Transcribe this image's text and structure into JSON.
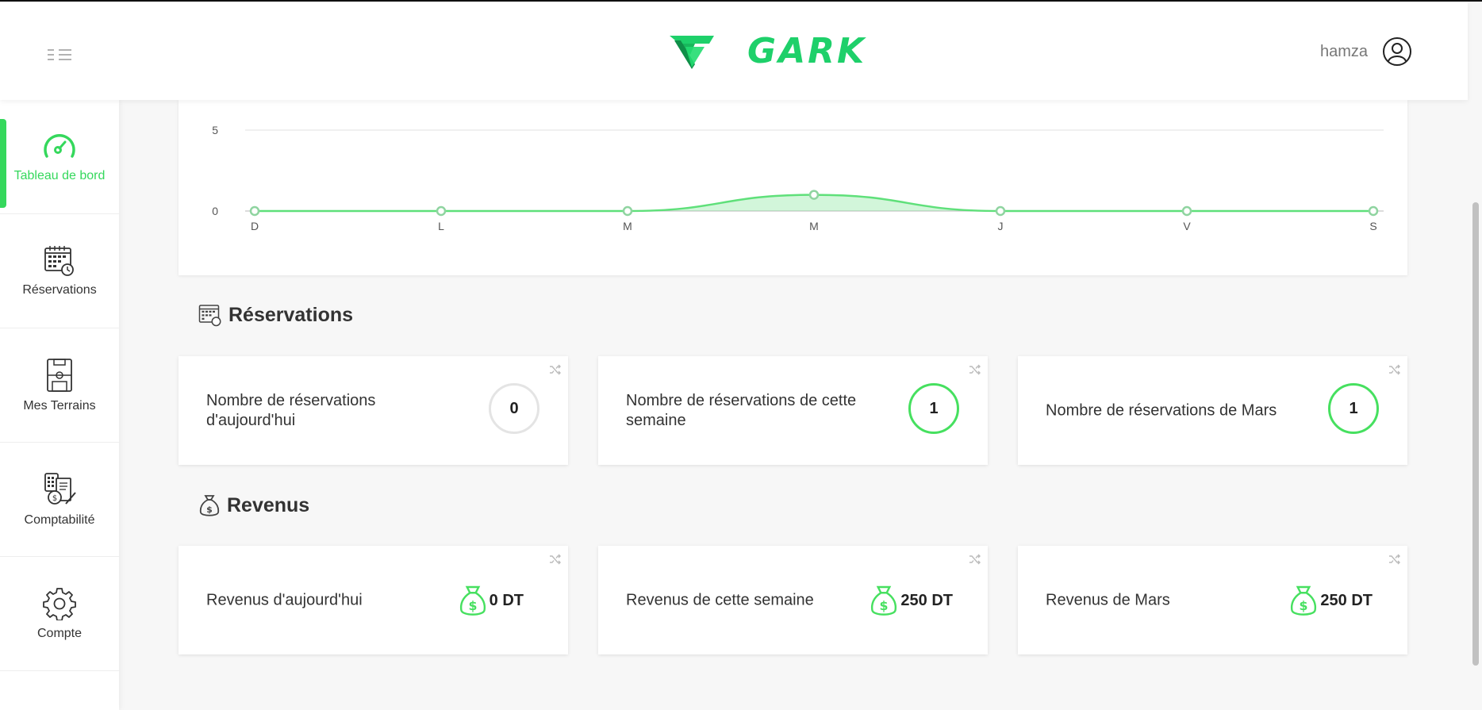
{
  "header": {
    "brand": "GARK",
    "user_name": "hamza"
  },
  "sidebar": {
    "items": [
      {
        "label": "Tableau de bord",
        "icon": "dashboard-gauge-icon",
        "active": true
      },
      {
        "label": "Réservations",
        "icon": "calendar-icon",
        "active": false
      },
      {
        "label": "Mes Terrains",
        "icon": "football-field-icon",
        "active": false
      },
      {
        "label": "Comptabilité",
        "icon": "accounting-icon",
        "active": false
      },
      {
        "label": "Compte",
        "icon": "gear-icon",
        "active": false
      }
    ]
  },
  "chart_data": {
    "type": "area",
    "categories": [
      "D",
      "L",
      "M",
      "M",
      "J",
      "V",
      "S"
    ],
    "series": [
      {
        "values": [
          0,
          0,
          0,
          1,
          0,
          0,
          0
        ]
      }
    ],
    "y_ticks": [
      "0",
      "5"
    ],
    "ylim": [
      0,
      5
    ],
    "grid": true,
    "color": "#5fe07a"
  },
  "reservations": {
    "title": "Réservations",
    "cards": [
      {
        "label": "Nombre de réservations d'aujourd'hui",
        "value": "0"
      },
      {
        "label": "Nombre de réservations de cette semaine",
        "value": "1"
      },
      {
        "label": "Nombre de réservations de Mars",
        "value": "1"
      }
    ]
  },
  "revenus": {
    "title": "Revenus",
    "cards": [
      {
        "label": "Revenus d'aujourd'hui",
        "value": "0 DT"
      },
      {
        "label": "Revenus de cette semaine",
        "value": "250 DT"
      },
      {
        "label": "Revenus de Mars",
        "value": "250 DT"
      }
    ]
  },
  "colors": {
    "accent": "#35d85c",
    "brand": "#1ed06a"
  }
}
